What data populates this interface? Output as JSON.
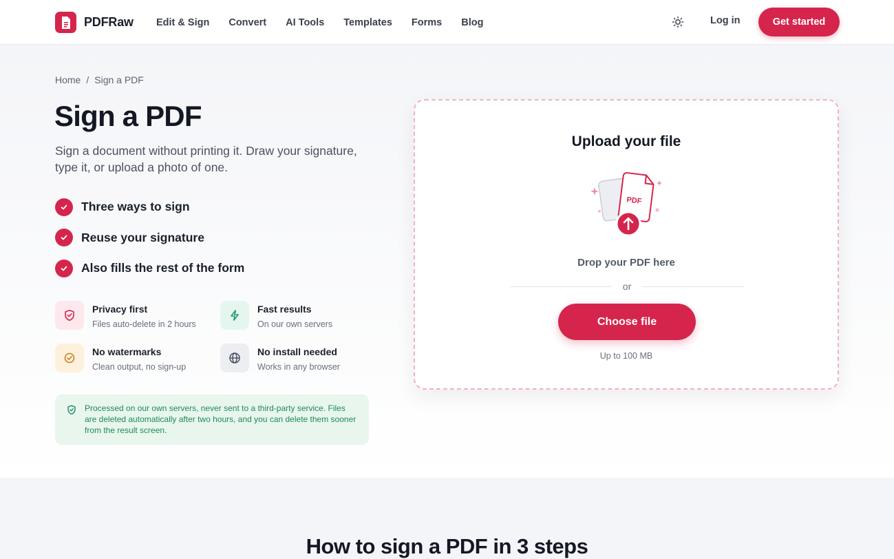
{
  "brand": {
    "name": "PDFRaw",
    "accent": "#d5254c"
  },
  "nav": {
    "items": [
      "Edit & Sign",
      "Convert",
      "AI Tools",
      "Templates",
      "Forms",
      "Blog"
    ]
  },
  "header": {
    "login_label": "Log in",
    "cta_label": "Get started"
  },
  "breadcrumb": {
    "home": "Home",
    "separator": "/",
    "current": "Sign a PDF"
  },
  "hero": {
    "title": "Sign a PDF",
    "subtitle": "Sign a document without printing it. Draw your signature, type it, or upload a photo of one.",
    "checks": [
      "Three ways to sign",
      "Reuse your signature",
      "Also fills the rest of the form"
    ]
  },
  "features": [
    {
      "title": "Privacy first",
      "desc": "Files auto-delete in 2 hours",
      "icon": "shield-icon"
    },
    {
      "title": "Fast results",
      "desc": "On our own servers",
      "icon": "lightning-icon"
    },
    {
      "title": "No watermarks",
      "desc": "Clean output, no sign-up",
      "icon": "check-circle-icon"
    },
    {
      "title": "No install needed",
      "desc": "Works in any browser",
      "icon": "globe-icon"
    }
  ],
  "privacy_note": "Processed on our own servers, never sent to a third-party service. Files are deleted automatically after two hours, and you can delete them sooner from the result screen.",
  "upload": {
    "title": "Upload your file",
    "badge": "PDF",
    "drop_text": "Drop your PDF here",
    "or_text": "or",
    "button_label": "Choose file",
    "limit_text": "Up to 100 MB"
  },
  "steps_section": {
    "title": "How to sign a PDF in 3 steps"
  }
}
